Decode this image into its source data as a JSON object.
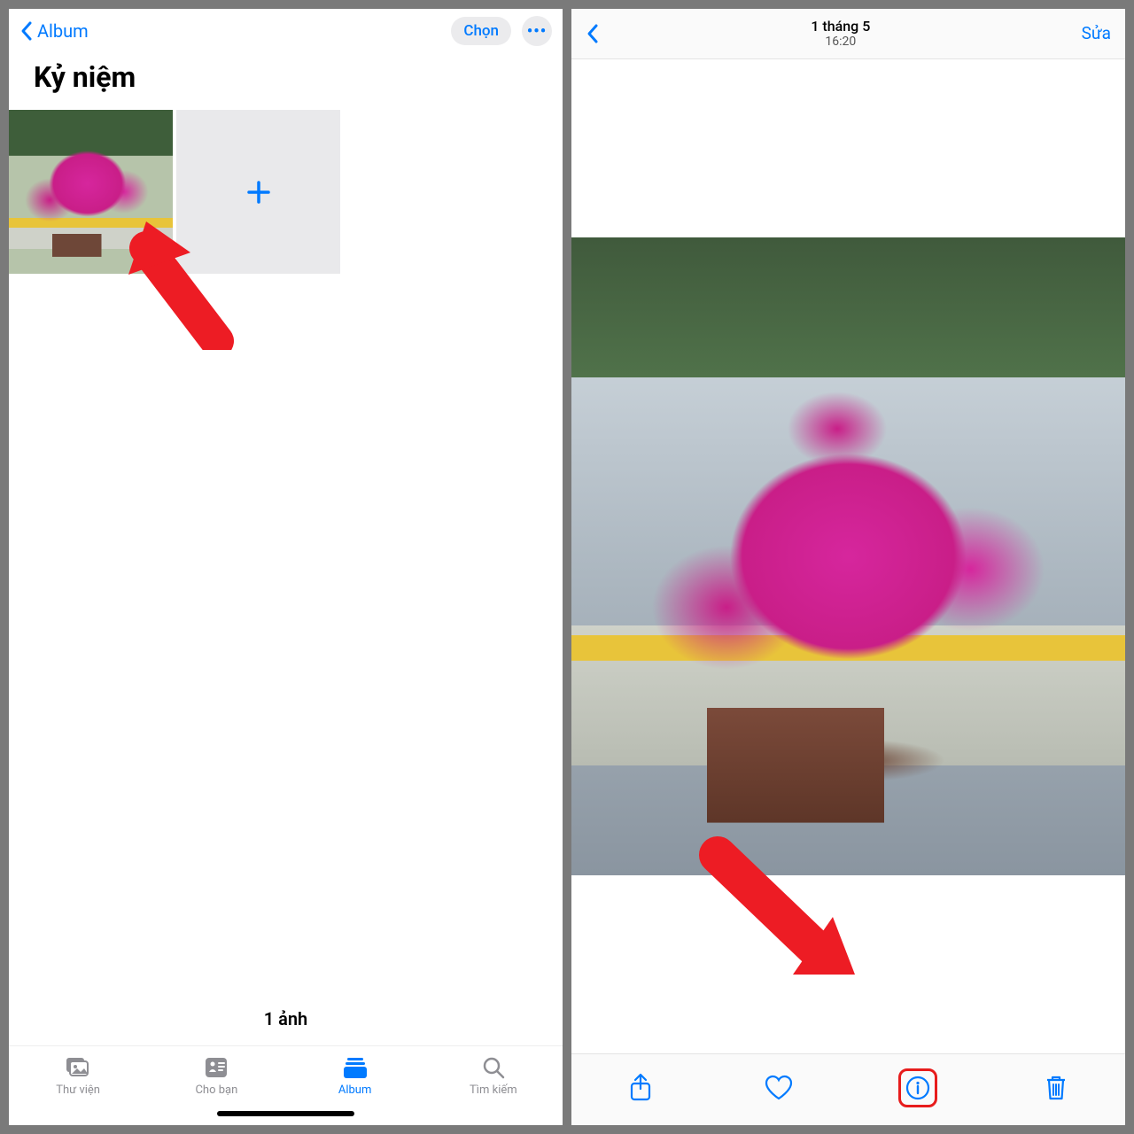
{
  "left": {
    "backLabel": "Album",
    "selectLabel": "Chọn",
    "title": "Kỷ niệm",
    "count": "1 ảnh",
    "tabs": {
      "library": "Thư viện",
      "forYou": "Cho bạn",
      "album": "Album",
      "search": "Tìm kiếm"
    }
  },
  "right": {
    "date": "1 tháng 5",
    "time": "16:20",
    "edit": "Sửa"
  }
}
